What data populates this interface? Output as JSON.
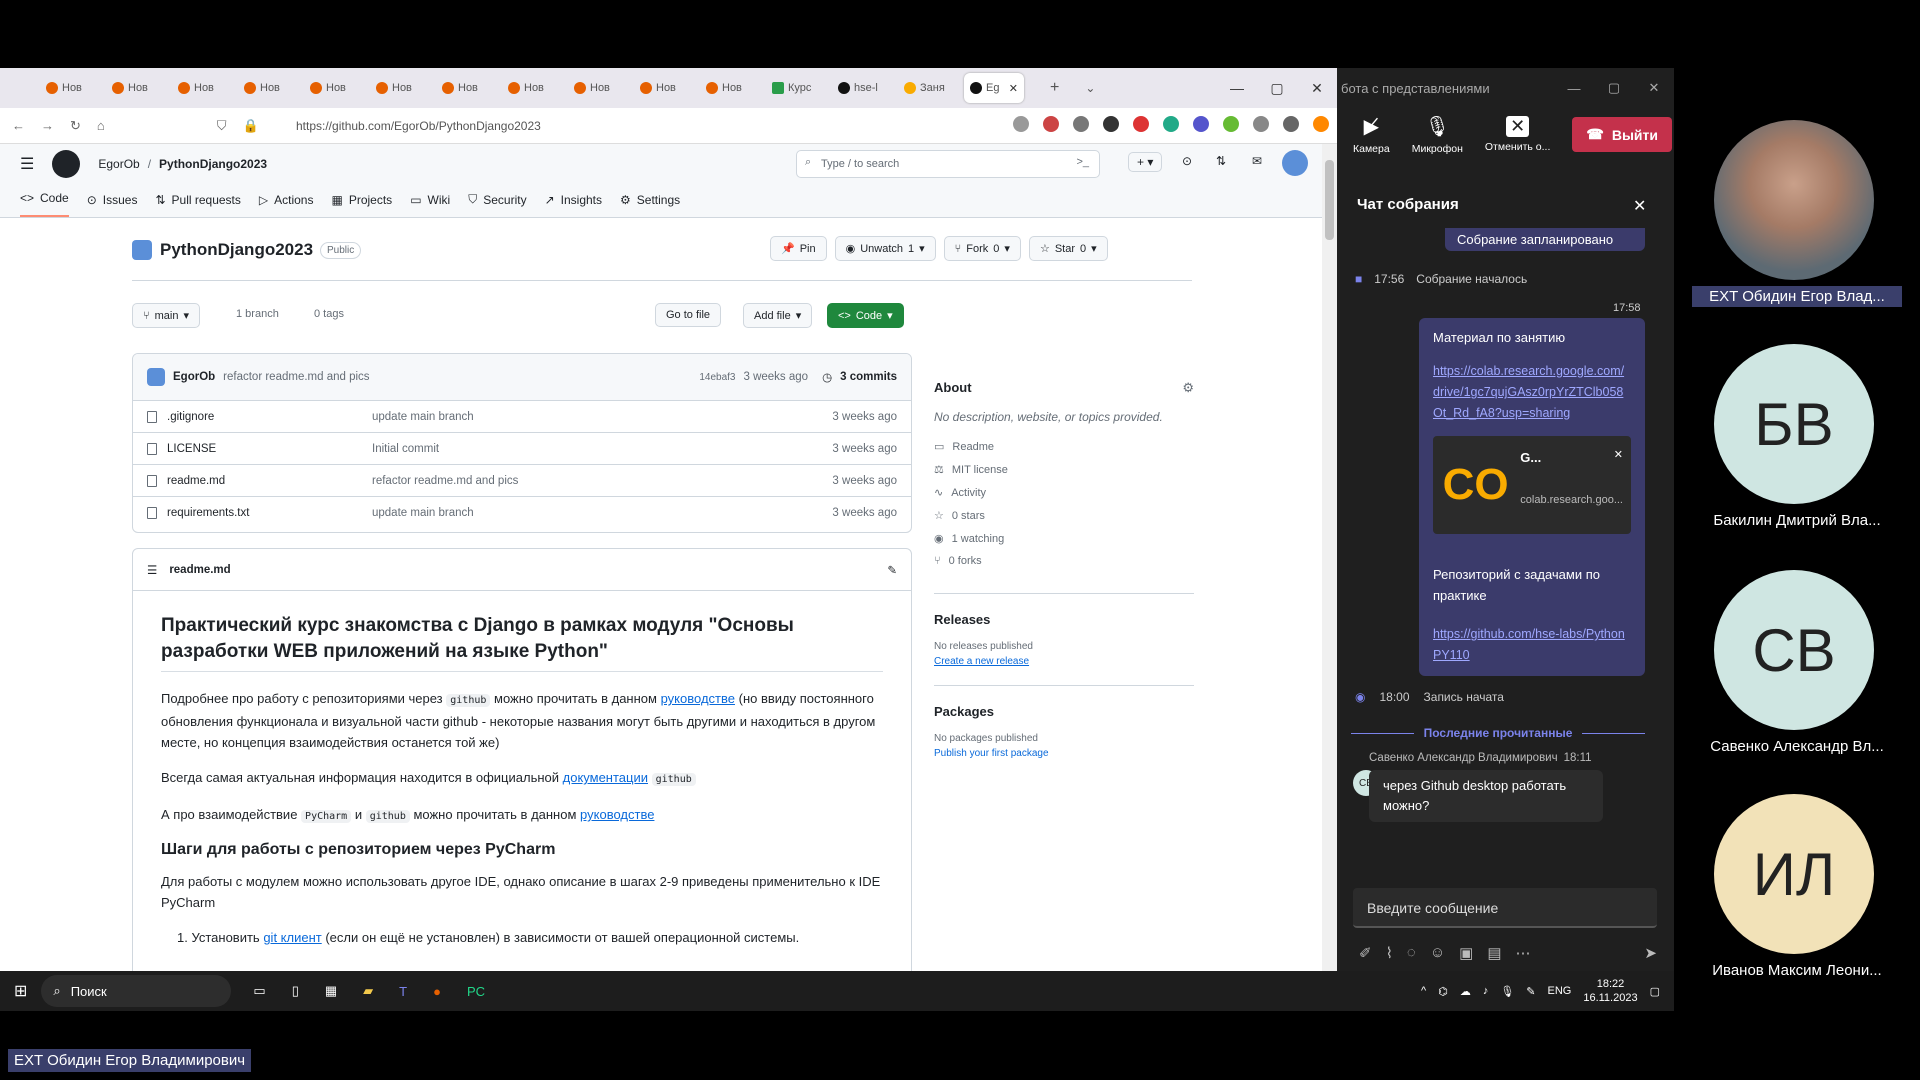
{
  "browser": {
    "tabs": [
      "Нов",
      "Нов",
      "Нов",
      "Нов",
      "Нов",
      "Нов",
      "Нов",
      "Нов",
      "Нов",
      "Нов",
      "Нов",
      "Курс",
      "hse-l",
      "Заня",
      "Eg"
    ],
    "url": "https://github.com/EgorOb/PythonDjango2023"
  },
  "github": {
    "owner": "EgorOb",
    "repo": "PythonDjango2023",
    "search_placeholder": "Type / to search",
    "nav": [
      "Code",
      "Issues",
      "Pull requests",
      "Actions",
      "Projects",
      "Wiki",
      "Security",
      "Insights",
      "Settings"
    ],
    "repo_title": "PythonDjango2023",
    "visibility": "Public",
    "pin": "Pin",
    "unwatch": "Unwatch",
    "unwatch_count": "1",
    "fork": "Fork",
    "fork_count": "0",
    "star": "Star",
    "star_count": "0",
    "branch": "main",
    "branches": "1 branch",
    "tags": "0 tags",
    "go_to_file": "Go to file",
    "add_file": "Add file",
    "code_btn": "Code",
    "commit_author": "EgorOb",
    "commit_msg": "refactor readme.md and pics",
    "commit_hash": "14ebaf3",
    "commit_time": "3 weeks ago",
    "commits": "3 commits",
    "files": [
      {
        "name": ".gitignore",
        "msg": "update main branch",
        "time": "3 weeks ago"
      },
      {
        "name": "LICENSE",
        "msg": "Initial commit",
        "time": "3 weeks ago"
      },
      {
        "name": "readme.md",
        "msg": "refactor readme.md and pics",
        "time": "3 weeks ago"
      },
      {
        "name": "requirements.txt",
        "msg": "update main branch",
        "time": "3 weeks ago"
      }
    ],
    "about_title": "About",
    "about_desc": "No description, website, or topics provided.",
    "about_items": [
      "Readme",
      "MIT license",
      "Activity",
      "0 stars",
      "1 watching",
      "0 forks"
    ],
    "releases_title": "Releases",
    "releases_none": "No releases published",
    "releases_link": "Create a new release",
    "packages_title": "Packages",
    "packages_none": "No packages published",
    "packages_link": "Publish your first package",
    "readme_label": "readme.md",
    "readme_h1": "Практический курс знакомства с Django в рамках модуля \"Основы разработки WEB приложений на языке Python\"",
    "p1a": "Подробнее про работу с репозиториями через",
    "p1code": "github",
    "p1b": "можно прочитать в данном",
    "p1link": "руководстве",
    "p1c": "(но ввиду постоянного обновления функционала и визуальной части github - некоторые названия могут быть другими и находиться в другом месте, но концепция взаимодействия останется той же)",
    "p2a": "Всегда самая актуальная информация находится в официальной",
    "p2link": "документации",
    "p2code": "github",
    "p3a": "А про взаимодействие",
    "p3code1": "PyCharm",
    "p3b": "и",
    "p3code2": "github",
    "p3c": "можно прочитать в данном",
    "p3link": "руководстве",
    "h2": "Шаги для работы с репозиторием через PyCharm",
    "p4": "Для работы с модулем можно использовать другое IDE, однако описание в шагах 2-9 приведены применительно к IDE PyCharm",
    "li1a": "Установить",
    "li1link": "git клиент",
    "li1b": "(если он ещё не установлен) в зависимости от вашей операционной системы."
  },
  "teams": {
    "window_title": "бота с представлениями",
    "camera": "Камера",
    "mic": "Микрофон",
    "share": "Отменить о...",
    "leave": "Выйти",
    "chat_title": "Чат собрания",
    "scheduled": "Собрание запланировано",
    "started_time": "17:56",
    "started": "Собрание началось",
    "msg_time": "17:58",
    "msg1_title": "Материал по занятию",
    "msg1_link": "https://colab.research.google.com/drive/1gc7qujGAsz0rpYrZTClb058Ot_Rd_fA8?usp=sharing",
    "card_title": "G...",
    "card_domain": "colab.research.goo...",
    "msg2_title": "Репозиторий с задачами по практике",
    "msg2_link": "https://github.com/hse-labs/PythonPY110",
    "rec_time": "18:00",
    "rec": "Запись начата",
    "last_read": "Последние прочитанные",
    "sender": "Савенко Александр Владимирович",
    "sender_time": "18:11",
    "sender_initials": "СВ",
    "sender_msg": "через Github desktop работать можно?",
    "input_placeholder": "Введите сообщение"
  },
  "people": [
    {
      "name": "EXT Обидин Егор Влад...",
      "initials": ""
    },
    {
      "name": "Бакилин Дмитрий Вла...",
      "initials": "БВ",
      "color": "#cfe6e2"
    },
    {
      "name": "Савенко Александр Вл...",
      "initials": "СВ",
      "color": "#cfe6e2"
    },
    {
      "name": "Иванов Максим Леони...",
      "initials": "ИЛ",
      "color": "#f2e2b8"
    }
  ],
  "taskbar": {
    "search": "Поиск",
    "lang": "ENG",
    "time": "18:22",
    "date": "16.11.2023"
  },
  "bottom_label": "EXT Обидин Егор Владимирович"
}
